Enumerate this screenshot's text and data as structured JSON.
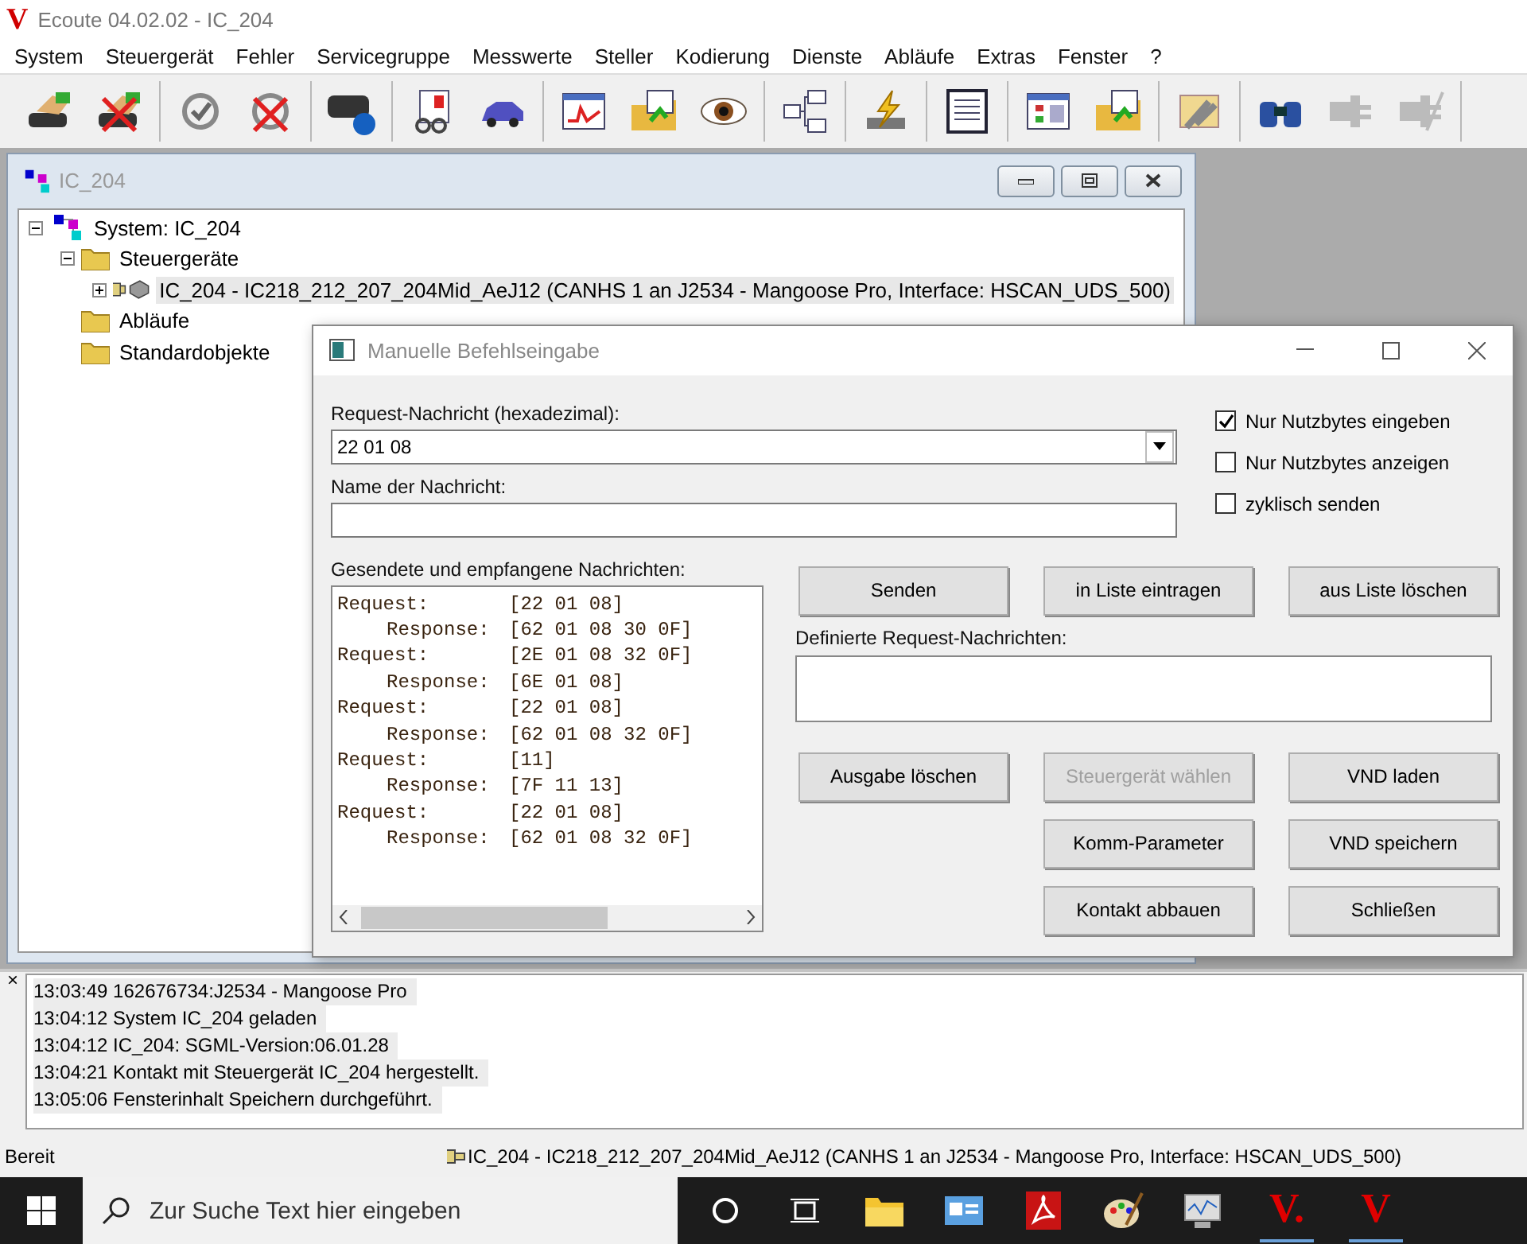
{
  "app_window": {
    "logo": "V",
    "title": "Ecoute 04.02.02 - IC_204"
  },
  "menu": [
    "System",
    "Steuergerät",
    "Fehler",
    "Servicegruppe",
    "Messwerte",
    "Steller",
    "Kodierung",
    "Dienste",
    "Abläufe",
    "Extras",
    "Fenster",
    "?"
  ],
  "toolbar": [
    [
      {
        "disabled": false
      },
      {
        "disabled": false
      }
    ],
    [
      {
        "disabled": false
      },
      {
        "disabled": false
      }
    ],
    [
      {
        "disabled": false
      }
    ],
    [
      {
        "disabled": false
      },
      {
        "disabled": false
      }
    ],
    [
      {
        "disabled": false
      },
      {
        "disabled": false
      },
      {
        "disabled": false
      }
    ],
    [
      {
        "disabled": false
      }
    ],
    [
      {
        "disabled": false
      }
    ],
    [
      {
        "disabled": false
      }
    ],
    [
      {
        "disabled": false
      },
      {
        "disabled": false
      }
    ],
    [
      {
        "disabled": false
      }
    ],
    [
      {
        "disabled": false
      },
      {
        "disabled": true
      },
      {
        "disabled": true
      }
    ]
  ],
  "child_window": {
    "title": "IC_204",
    "tree": [
      {
        "label": "System: IC_204",
        "kind": "system",
        "expanded": true,
        "selected": false,
        "children": [
          {
            "label": "Steuergeräte",
            "kind": "folder",
            "expanded": true,
            "selected": false,
            "children": [
              {
                "label": "IC_204 - IC218_212_207_204Mid_AeJ12 (CANHS 1 an J2534 - Mangoose Pro, Interface: HSCAN_UDS_500)",
                "kind": "device",
                "expanded": false,
                "selected": true
              }
            ]
          },
          {
            "label": "Abläufe",
            "kind": "folder",
            "selected": false
          },
          {
            "label": "Standardobjekte",
            "kind": "folder",
            "selected": false
          }
        ]
      }
    ]
  },
  "dialog": {
    "title": "Manuelle Befehlseingabe",
    "request_label": "Request-Nachricht (hexadezimal):",
    "request_value": "22 01 08",
    "name_label": "Name der Nachricht:",
    "options": [
      {
        "label": "Nur Nutzbytes eingeben",
        "checked": true
      },
      {
        "label": "Nur Nutzbytes anzeigen",
        "checked": false
      },
      {
        "label": "zyklisch senden",
        "checked": false
      }
    ],
    "messages_label": "Gesendete und empfangene Nachrichten:",
    "messages": [
      {
        "kind": "request",
        "label": "Request:",
        "bytes": "[22 01 08]"
      },
      {
        "kind": "response",
        "label": "Response:",
        "bytes": "[62 01 08 30 0F]"
      },
      {
        "kind": "request",
        "label": "Request:",
        "bytes": "[2E 01 08 32 0F]"
      },
      {
        "kind": "response",
        "label": "Response:",
        "bytes": "[6E 01 08]"
      },
      {
        "kind": "request",
        "label": "Request:",
        "bytes": "[22 01 08]"
      },
      {
        "kind": "response",
        "label": "Response:",
        "bytes": "[62 01 08 32 0F]"
      },
      {
        "kind": "request",
        "label": "Request:",
        "bytes": "[11]"
      },
      {
        "kind": "response",
        "label": "Response:",
        "bytes": "[7F 11 13]"
      },
      {
        "kind": "request",
        "label": "Request:",
        "bytes": "[22 01 08]"
      },
      {
        "kind": "response",
        "label": "Response:",
        "bytes": "[62 01 08 32 0F]"
      }
    ],
    "top_buttons": [
      {
        "label": "Senden",
        "disabled": false
      },
      {
        "label": "in Liste eintragen",
        "disabled": false
      },
      {
        "label": "aus Liste löschen",
        "disabled": false
      }
    ],
    "defined_label": "Definierte Request-Nachrichten:",
    "bottom_buttons": [
      {
        "label": "Ausgabe löschen",
        "disabled": false
      },
      {
        "label": "Steuergerät wählen",
        "disabled": true
      },
      {
        "label": "VND laden",
        "disabled": false
      },
      {
        "label": "Komm-Parameter",
        "disabled": false
      },
      {
        "label": "VND speichern",
        "disabled": false
      },
      {
        "label": "Kontakt abbauen",
        "disabled": false
      },
      {
        "label": "Schließen",
        "disabled": false
      }
    ]
  },
  "log": {
    "close": "×",
    "lines": [
      "13:03:49 162676734:J2534 - Mangoose Pro",
      "13:04:12 System IC_204 geladen",
      "13:04:12 IC_204: SGML-Version:06.01.28",
      "13:04:21 Kontakt mit Steuergerät IC_204 hergestellt.",
      "13:05:06 Fensterinhalt Speichern durchgeführt."
    ]
  },
  "status_bar": {
    "state": "Bereit",
    "connection": "IC_204 - IC218_212_207_204Mid_AeJ12 (CANHS 1 an J2534 - Mangoose Pro, Interface: HSCAN_UDS_500)"
  },
  "taskbar": {
    "search_placeholder": "Zur Suche Text hier eingeben",
    "app_letters": [
      "V.",
      "V"
    ]
  }
}
